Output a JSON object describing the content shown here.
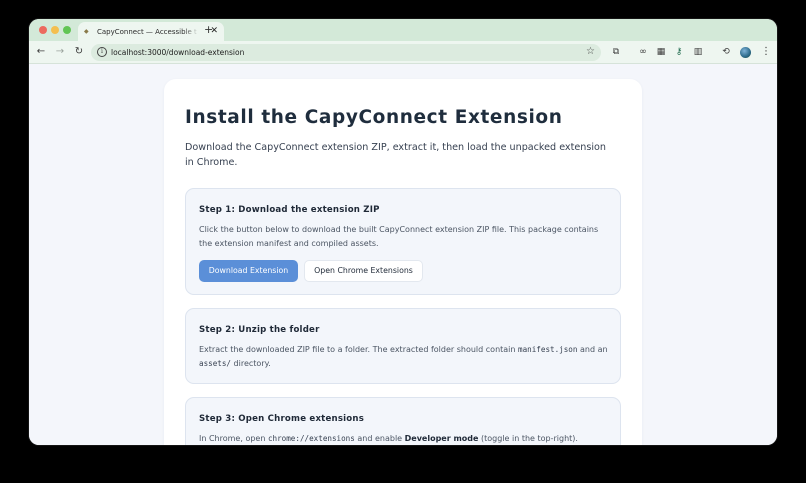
{
  "browser": {
    "tab": {
      "favicon": "capybara-favicon-icon",
      "title": "CapyConnect — Accessible t",
      "close_icon": "✕"
    },
    "new_tab_icon": "+",
    "url": "localhost:3000/download-extension"
  },
  "page": {
    "title": "Install the CapyConnect Extension",
    "intro": "Download the CapyConnect extension ZIP, extract it, then load the unpacked extension in Chrome.",
    "steps": [
      {
        "title": "Step 1: Download the extension ZIP",
        "text": "Click the button below to download the built CapyConnect extension ZIP file. This package contains the extension manifest and compiled assets.",
        "primary_button": "Download Extension",
        "secondary_button": "Open Chrome Extensions"
      },
      {
        "title": "Step 2: Unzip the folder",
        "text_1": "Extract the downloaded ZIP file to a folder. The extracted folder should contain ",
        "code_1": "manifest.json",
        "text_2": " and an ",
        "code_2": "assets/",
        "text_3": " directory."
      },
      {
        "title": "Step 3: Open Chrome extensions",
        "text_1": "In Chrome, open ",
        "code_1": "chrome://extensions",
        "text_2": " and enable ",
        "strong_1": "Developer mode",
        "text_3": " (toggle in the top-right)."
      }
    ]
  },
  "colors": {
    "primary_button": "#5b8fd8",
    "tab_strip": "#d3e9d8",
    "page_background": "#f4f6fb"
  }
}
